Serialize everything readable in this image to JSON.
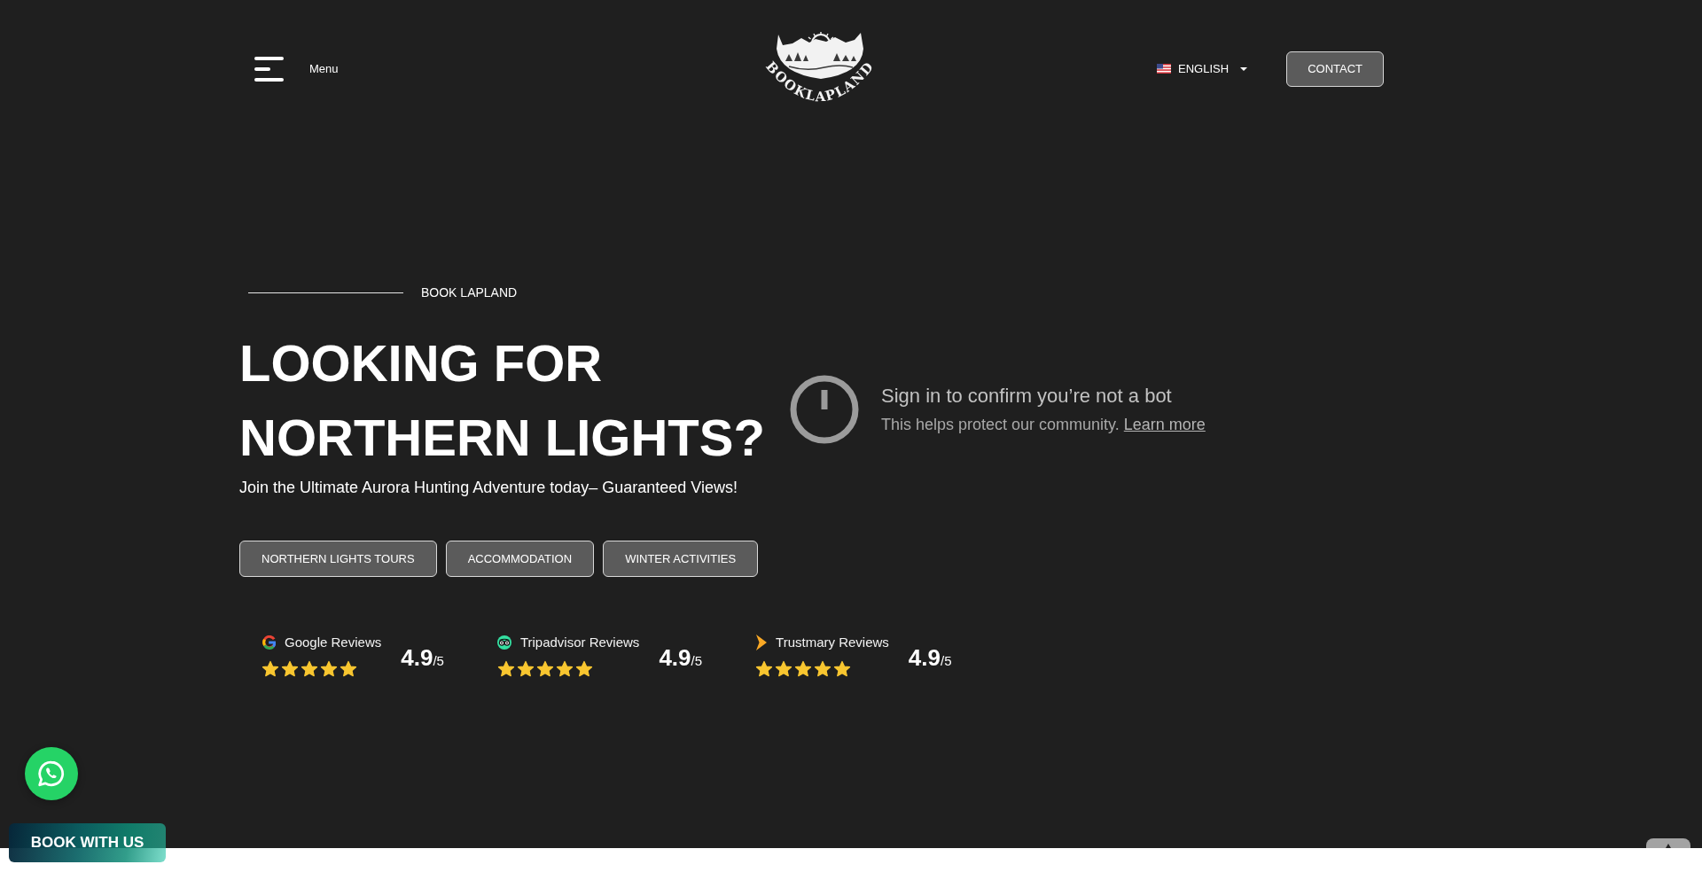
{
  "header": {
    "menu_label": "Menu",
    "logo_text": "BOOKLAPLAND",
    "language": "ENGLISH",
    "contact": "CONTACT"
  },
  "hero": {
    "eyebrow": "BOOK LAPLAND",
    "title": "LOOKING FOR NORTHERN LIGHTS?",
    "subtitle": "Join the Ultimate Aurora Hunting Adventure today– Guaranteed Views!",
    "buttons": [
      {
        "label": "NORTHERN LIGHTS TOURS"
      },
      {
        "label": "ACCOMMODATION"
      },
      {
        "label": "WINTER ACTIVITIES"
      }
    ],
    "reviews": [
      {
        "kind": "google",
        "label": "Google Reviews",
        "stars": 5,
        "score": "4.9",
        "scale": "/5"
      },
      {
        "kind": "tripadvisor",
        "label": "Tripadvisor Reviews",
        "stars": 5,
        "score": "4.9",
        "scale": "/5"
      },
      {
        "kind": "trustmary",
        "label": "Trustmary Reviews",
        "stars": 5,
        "score": "4.9",
        "scale": "/5"
      }
    ]
  },
  "notice": {
    "title": "Sign in to confirm you’re not a bot",
    "message": "This helps protect our community.",
    "link": "Learn more"
  },
  "book_button": "BOOK WITH US"
}
